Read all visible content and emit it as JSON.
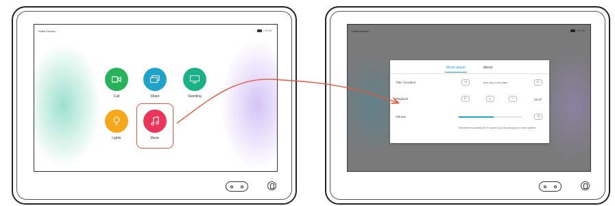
{
  "left_device": {
    "topbar_title": "Kefke Kosnts •",
    "topbar_time": "|  12:35",
    "tiles": [
      {
        "label": "Call",
        "color": "#27b35a",
        "icon": "video-camera-icon"
      },
      {
        "label": "Share",
        "color": "#1fa3c9",
        "icon": "screen-share-icon"
      },
      {
        "label": "Standing",
        "color": "#19b286",
        "icon": "monitor-icon"
      },
      {
        "label": "Lights",
        "color": "#f6a71c",
        "icon": "lightbulb-icon"
      },
      {
        "label": "Music",
        "color": "#e9365a",
        "icon": "music-note-icon"
      }
    ],
    "highlight_color": "#e8563c"
  },
  "right_device": {
    "topbar_title": "Kefke Kosnts •",
    "topbar_time": "|  12:35",
    "panel": {
      "tabs": [
        {
          "label": "Music player",
          "active": true
        },
        {
          "label": "About",
          "active": false
        }
      ],
      "rows": {
        "title_label": "Title / Duration",
        "prev_glyph": "◁",
        "now_playing_text": "Now play to mai player",
        "next_glyph": "▷",
        "playback_label": "Playback",
        "play_glyph": "▷",
        "pause_glyph": "II",
        "stop_glyph": "□",
        "duration": "03:37",
        "volume_label": "Volume",
        "mute_glyph": "◁",
        "volume_level": 0.55,
        "hint_text": "Remember to present the IT source if you are playing on a video system."
      },
      "accent_color": "#1fa3c9"
    }
  },
  "arrow_color": "#e8563c"
}
